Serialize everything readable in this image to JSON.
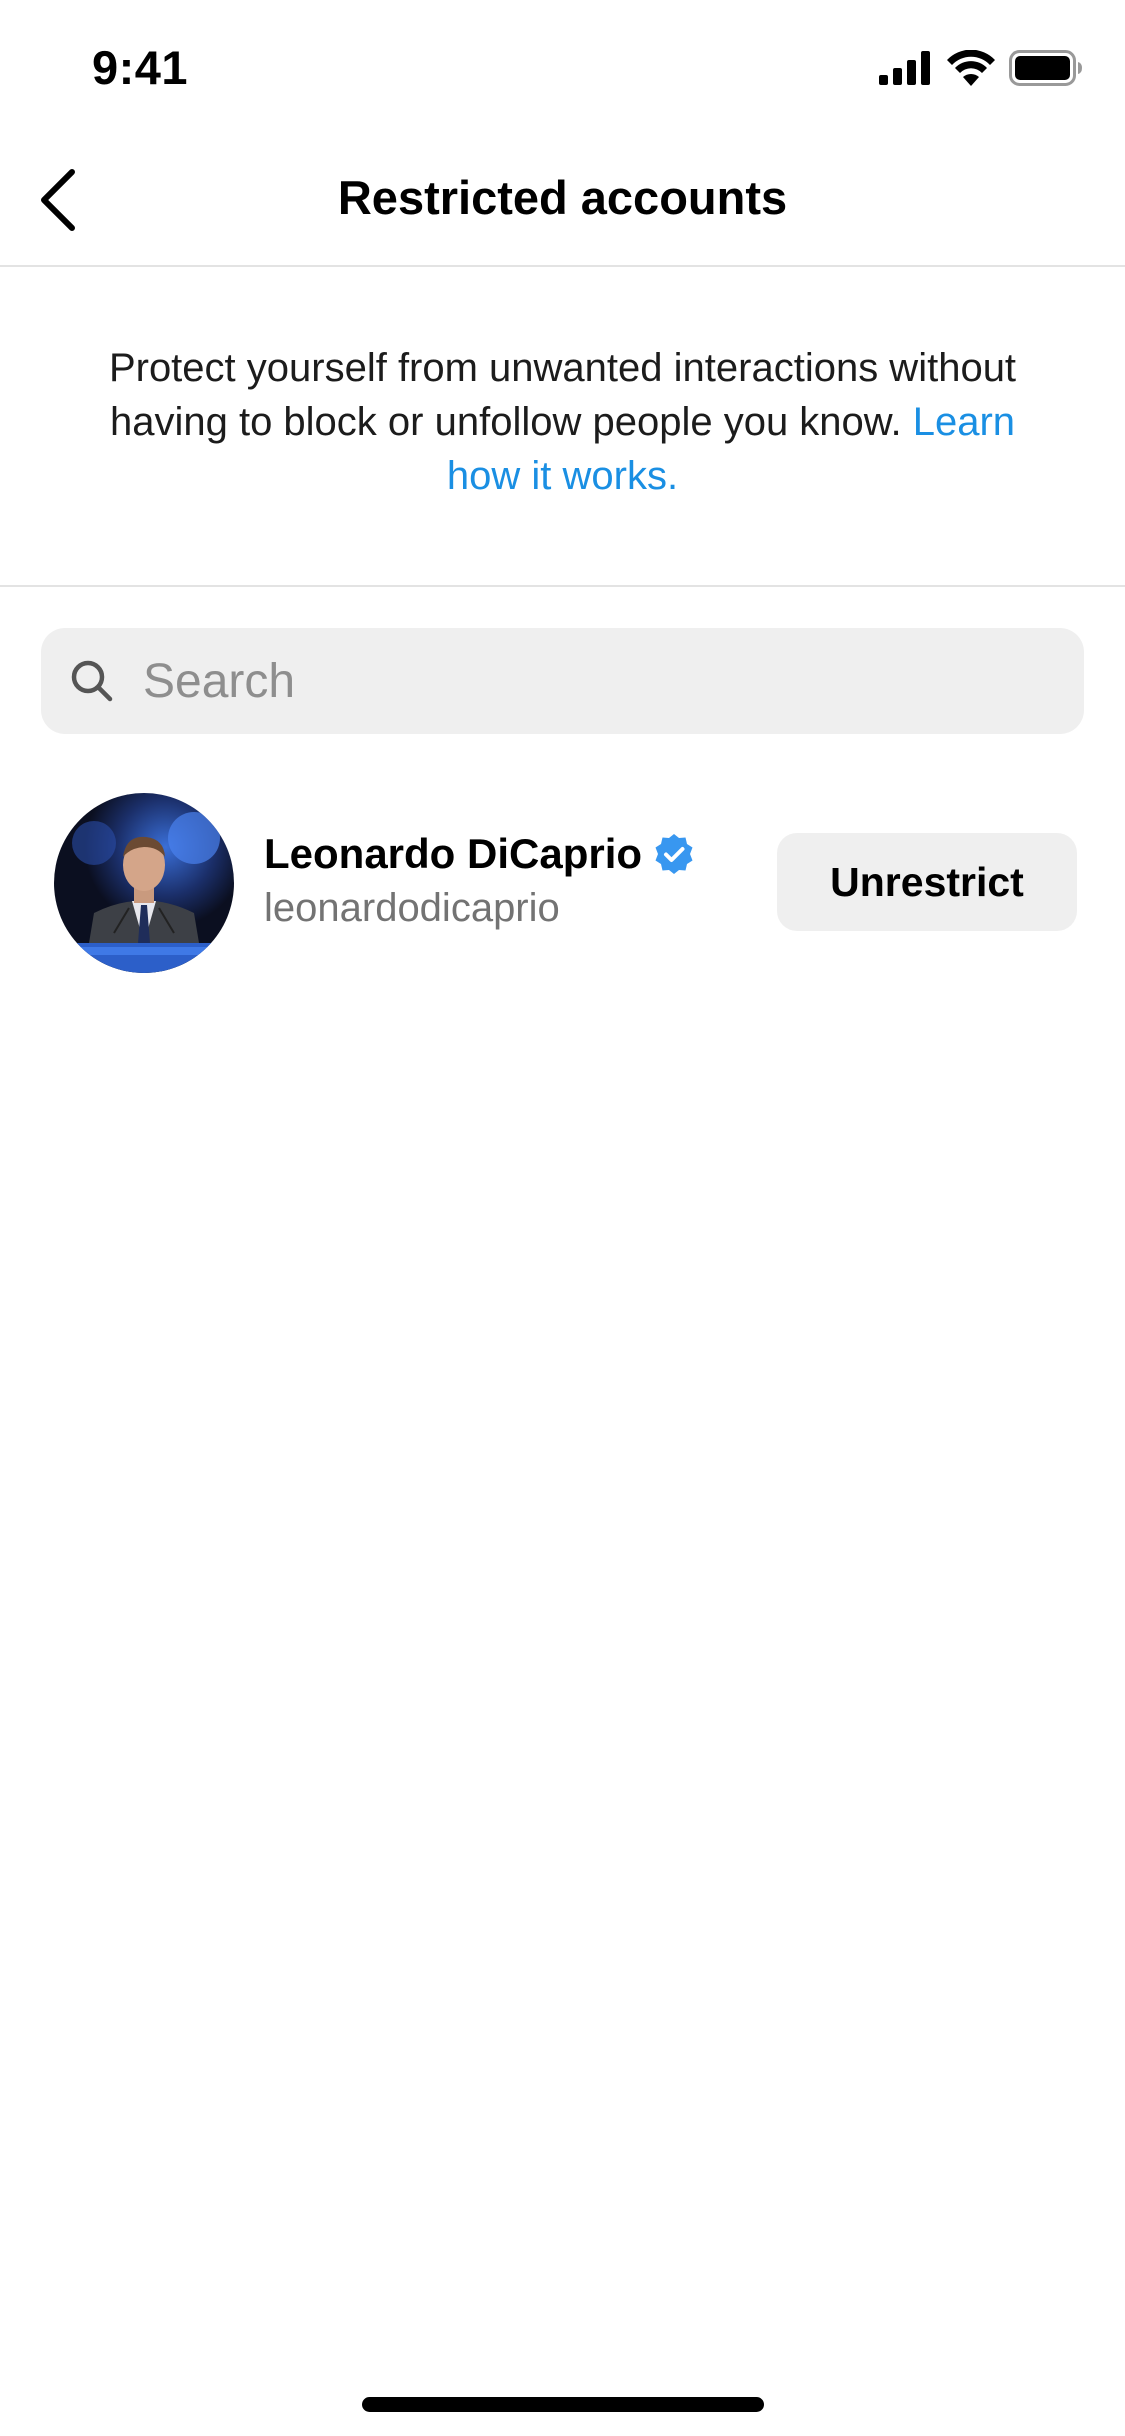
{
  "status_bar": {
    "time": "9:41",
    "icons": [
      "cellular-signal-icon",
      "wifi-icon",
      "battery-icon"
    ]
  },
  "header": {
    "back_icon": "chevron-left-icon",
    "title": "Restricted accounts"
  },
  "description": {
    "text": "Protect yourself from unwanted interactions without having to block or unfollow people you know.",
    "link_text": "Learn how it works.",
    "link_color": "#1a8fe3"
  },
  "search": {
    "icon": "search-icon",
    "placeholder": "Search",
    "value": ""
  },
  "accounts": [
    {
      "display_name": "Leonardo DiCaprio",
      "username": "leonardodicaprio",
      "verified": true,
      "verified_color": "#3897f0",
      "action_label": "Unrestrict"
    }
  ]
}
